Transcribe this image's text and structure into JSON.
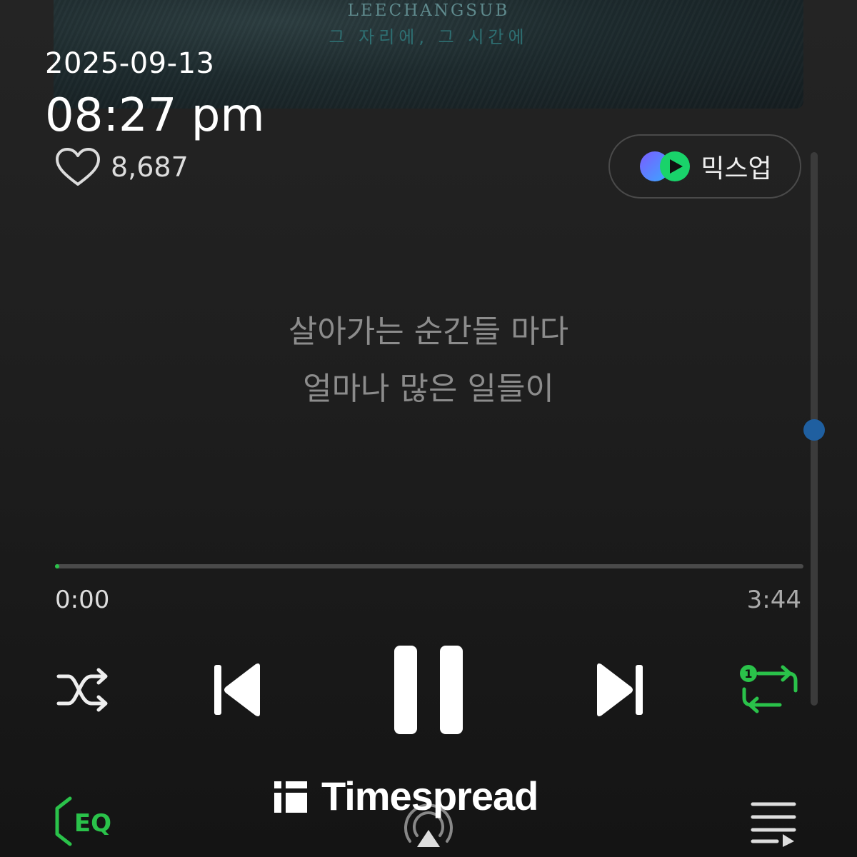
{
  "album": {
    "artist": "LEECHANGSUB",
    "title": "그 자리에, 그 시간에"
  },
  "status": {
    "date": "2025-09-13",
    "time": "08:27 pm"
  },
  "like": {
    "count": "8,687",
    "icon": "heart-icon"
  },
  "mixup": {
    "label": "믹스업",
    "icon": "mixup-logo-icon"
  },
  "lyrics": {
    "line1": "살아가는 순간들 마다",
    "line2": "얼마나 많은 일들이"
  },
  "progress": {
    "elapsed": "0:00",
    "total": "3:44",
    "fraction": 0.005
  },
  "controls": {
    "shuffle_icon": "shuffle-icon",
    "prev_icon": "skip-previous-icon",
    "pause_icon": "pause-icon",
    "next_icon": "skip-next-icon",
    "repeat_icon": "repeat-one-icon",
    "repeat_badge": "1"
  },
  "bottom_bar": {
    "eq_label": "EQ",
    "airplay_icon": "airplay-icon",
    "playlist_icon": "playlist-icon"
  },
  "watermark": {
    "text": "Timespread"
  },
  "colors": {
    "accent": "#2ac24a",
    "background": "#1f1f1f",
    "scroll_thumb": "#1f5fa0"
  }
}
